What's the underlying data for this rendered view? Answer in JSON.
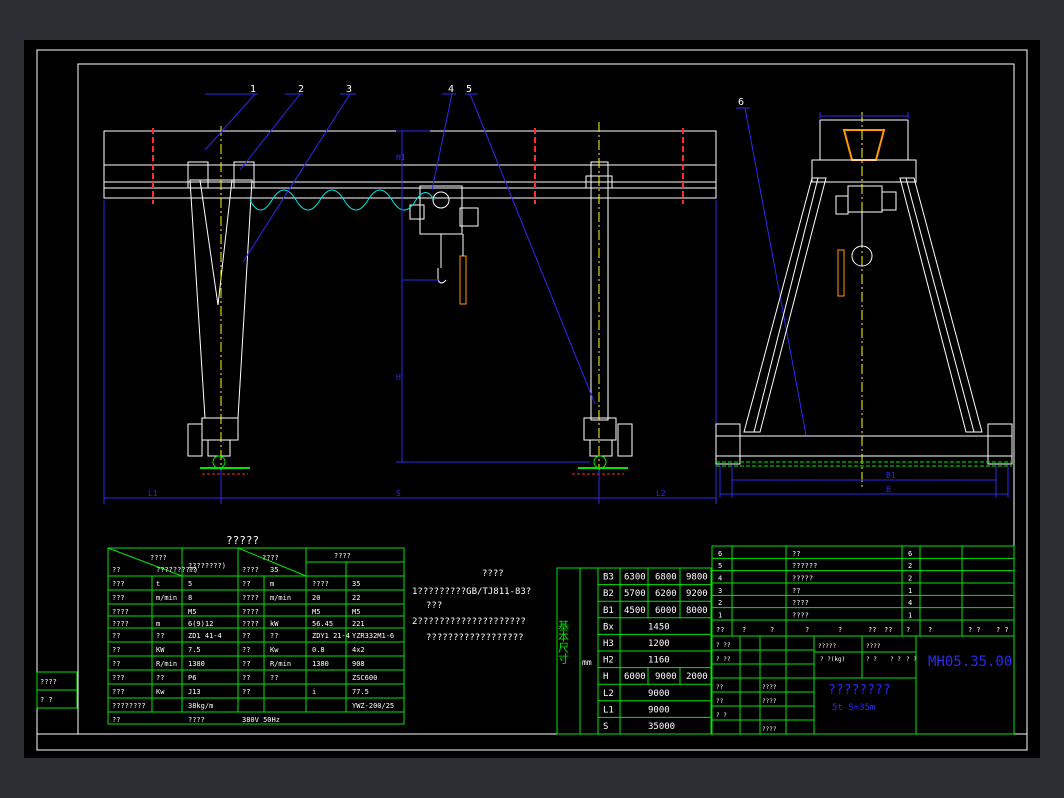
{
  "view_labels": {
    "title_small": "?????",
    "drawing_number": "MH05.35.00",
    "drawing_name": "????????",
    "drawing_sub": "5t   S=35m"
  },
  "callouts": [
    "1",
    "2",
    "3",
    "4",
    "5",
    "6"
  ],
  "dim_labels": {
    "l1": "L1",
    "s": "S",
    "l2": "L2",
    "h": "H",
    "h1": "H1",
    "b": "B",
    "b1": "B1",
    "front_small": "5t"
  },
  "notes": {
    "heading": "????",
    "line1": "1?????????GB/TJ811-83?",
    "line2": "???",
    "line3": "2????????????????????",
    "line4": "??????????????????"
  },
  "spec_table": {
    "header_a": "????",
    "header_b": "????????)",
    "header_c": "????",
    "header_d": "????",
    "rows": [
      [
        "??",
        "?????????)",
        "??",
        "????",
        "35"
      ],
      [
        "???",
        "t",
        "5",
        "??",
        "m",
        "????",
        "35"
      ],
      [
        "???",
        "m/min",
        "8",
        "????",
        "m/min",
        "20",
        "22"
      ],
      [
        "????",
        "",
        "M5",
        "????",
        "",
        "M5",
        "M5"
      ],
      [
        "????",
        "m",
        "6(9)12",
        "????",
        "kW",
        "56.45",
        "221"
      ],
      [
        "??",
        "??",
        "ZD1 41-4",
        "??",
        "??",
        "ZDY1 21-4",
        "YZR332M1-6"
      ],
      [
        "??",
        "KW",
        "7.5",
        "??",
        "Kw",
        "0.8",
        "4x2"
      ],
      [
        "??",
        "R/min",
        "1380",
        "??",
        "R/min",
        "1380",
        "908"
      ],
      [
        "???",
        "??",
        "P6",
        "??",
        "??",
        "",
        "ZSC600"
      ],
      [
        "???",
        "Kw",
        "J13",
        "??",
        "",
        "i",
        "77.5"
      ],
      [
        "????????",
        "",
        "38kg/m",
        "",
        "",
        "",
        "YWZ-200/25"
      ],
      [
        "??",
        "",
        "????",
        "380V  50Hz",
        "",
        ""
      ]
    ]
  },
  "dims_table": {
    "side_label": "基本尺寸",
    "unit": "mm",
    "rows": [
      {
        "k": "B3",
        "v": [
          "6300",
          "6800",
          "9800"
        ]
      },
      {
        "k": "B2",
        "v": [
          "5700",
          "6200",
          "9200"
        ]
      },
      {
        "k": "B1",
        "v": [
          "4500",
          "6000",
          "8000"
        ]
      },
      {
        "k": "Bx",
        "v": [
          "1450"
        ]
      },
      {
        "k": "H3",
        "v": [
          "1200"
        ]
      },
      {
        "k": "H2",
        "v": [
          "1160"
        ]
      },
      {
        "k": "H",
        "v": [
          "6000",
          "9000",
          "2000"
        ]
      },
      {
        "k": "L2",
        "v": [
          "9000"
        ]
      },
      {
        "k": "L1",
        "v": [
          "9000"
        ]
      },
      {
        "k": "S",
        "v": [
          "35000"
        ]
      }
    ]
  },
  "parts_list": {
    "rows": [
      [
        "6",
        "",
        "??",
        "",
        "",
        "6"
      ],
      [
        "5",
        "",
        "??????",
        "",
        "",
        "2"
      ],
      [
        "4",
        "",
        "?????",
        "",
        "",
        "2"
      ],
      [
        "3",
        "",
        "??",
        "",
        "",
        "1"
      ],
      [
        "2",
        "",
        "????",
        "",
        "",
        "4"
      ],
      [
        "1",
        "",
        "????",
        "",
        "",
        "1"
      ]
    ],
    "header": [
      "??",
      "?",
      "?",
      "?",
      "?",
      "??",
      "??",
      "?",
      "?",
      "? ?",
      "? ?"
    ]
  },
  "title_block": {
    "cells": [
      "? ??",
      "? ??",
      "????",
      "??",
      "??",
      "? ?",
      "? ?(kg)",
      "? ?",
      "? ?",
      "? ?",
      "?????",
      "????",
      "????",
      "????"
    ]
  },
  "left_mini": [
    "????",
    "? ?"
  ],
  "colors": {
    "background": "#000000",
    "frame": "#ffffff",
    "outline": "#ffffff",
    "blue": "#2a2af0",
    "green": "#00e600",
    "red": "#ff2a2a",
    "yellow": "#ffff00",
    "cyan": "#00ffff",
    "magenta": "#ff40ff",
    "orange": "#ff9900"
  }
}
